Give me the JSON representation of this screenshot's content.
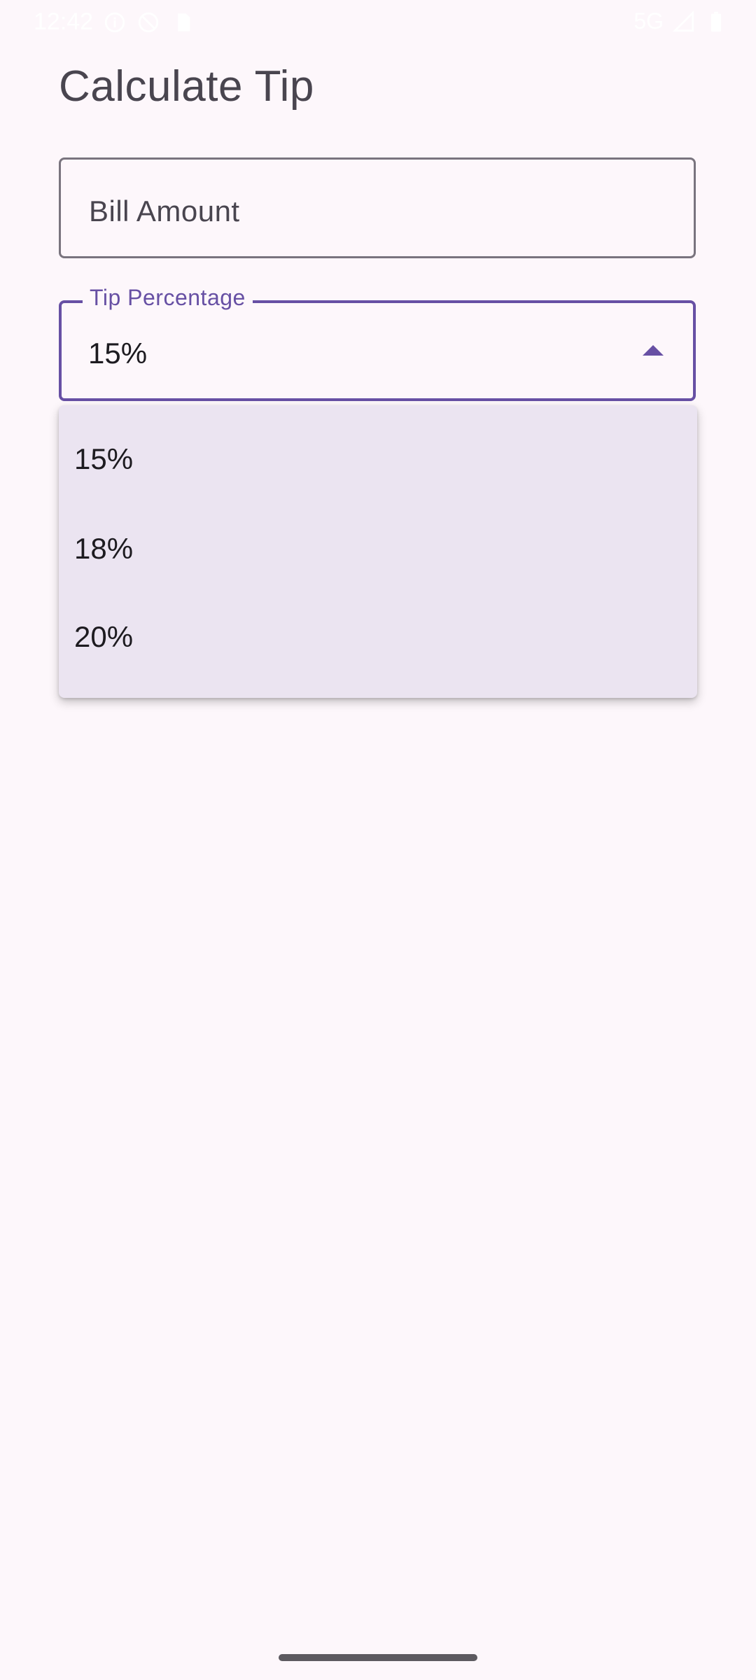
{
  "status_bar": {
    "time": "12:42",
    "network": "5G",
    "left_icons": [
      "info-icon",
      "dnd-icon",
      "sim-card-icon"
    ],
    "right_icons": [
      "signal-icon",
      "battery-icon"
    ]
  },
  "screen": {
    "title": "Calculate Tip"
  },
  "bill_field": {
    "placeholder": "Bill Amount"
  },
  "tip_field": {
    "label": "Tip Percentage",
    "value": "15%",
    "expanded": true
  },
  "dropdown": {
    "options": [
      "15%",
      "18%",
      "20%"
    ]
  },
  "colors": {
    "background": "#fdf7fb",
    "accent": "#6750a4",
    "menu_background": "#ebe4f1",
    "outline": "#79747e"
  }
}
